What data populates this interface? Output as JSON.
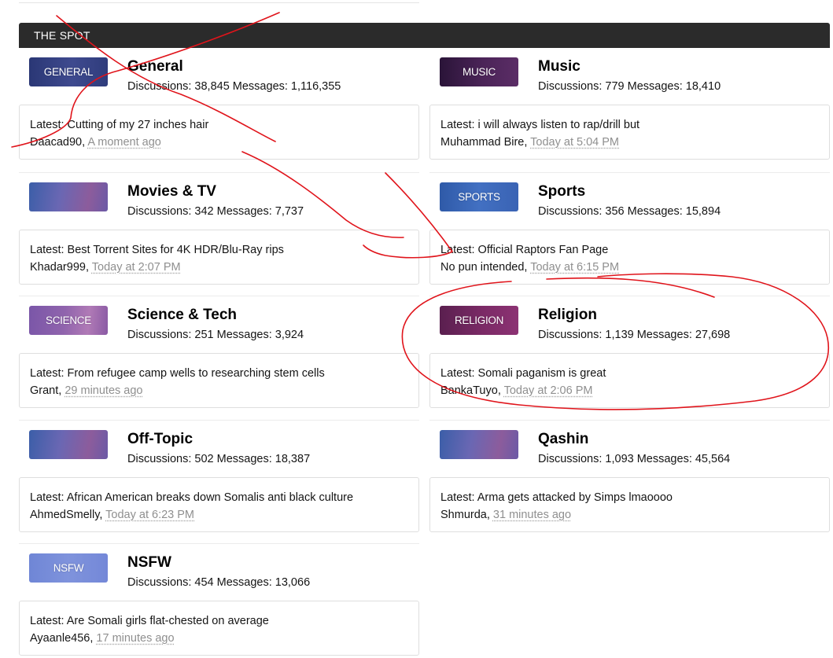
{
  "section": {
    "title": "THE SPOT"
  },
  "forums": [
    {
      "title": "General",
      "icon_label": "GENERAL",
      "icon_bg": "linear-gradient(90deg, #2a3775 0%, #3f4a8f 55%, #2f3c7c 100%)",
      "stats": "Discussions: 38,845 Messages: 1,116,355",
      "latest_title": "Latest: Cutting of my 27 inches hair",
      "latest_user": "Daacad90",
      "latest_time": "A moment ago"
    },
    {
      "title": "Music",
      "icon_label": "MUSIC",
      "icon_bg": "linear-gradient(90deg, #2a1438 0%, #4b2458 55%, #5b2d66 100%)",
      "stats": "Discussions: 779 Messages: 18,410",
      "latest_title": "Latest: i will always listen to rap/drill but",
      "latest_user": "Muhammad Bire",
      "latest_time": "Today at 5:04 PM"
    },
    {
      "title": "Movies & TV",
      "icon_label": "",
      "icon_bg": "linear-gradient(100deg, #3b5ea8 0%, #6a67b3 40%, #8c5c9c 75%, #6b5aa6 100%)",
      "stats": "Discussions: 342 Messages: 7,737",
      "latest_title": "Latest: Best Torrent Sites for 4K HDR/Blu-Ray rips",
      "latest_user": "Khadar999",
      "latest_time": "Today at 2:07 PM"
    },
    {
      "title": "Sports",
      "icon_label": "SPORTS",
      "icon_bg": "linear-gradient(90deg, #2f5aa8 0%, #4270c2 50%, #3a63b4 100%)",
      "stats": "Discussions: 356 Messages: 15,894",
      "latest_title": "Latest: Official Raptors Fan Page",
      "latest_user": "No pun intended",
      "latest_time": "Today at 6:15 PM"
    },
    {
      "title": "Science & Tech",
      "icon_label": "SCIENCE",
      "icon_bg": "linear-gradient(95deg, #7a56a8 0%, #9064ad 45%, #b07ab6 75%, #8a5aa4 100%)",
      "stats": "Discussions: 251 Messages: 3,924",
      "latest_title": "Latest: From refugee camp wells to researching stem cells",
      "latest_user": "Grant",
      "latest_time": "29 minutes ago"
    },
    {
      "title": "Religion",
      "icon_label": "RELIGION",
      "icon_bg": "linear-gradient(90deg, #5a1f4f 0%, #7b2a66 55%, #8c3273 100%)",
      "stats": "Discussions: 1,139 Messages: 27,698",
      "latest_title": "Latest: Somali paganism is great",
      "latest_user": "BankaTuyo",
      "latest_time": "Today at 2:06 PM"
    },
    {
      "title": "Off-Topic",
      "icon_label": "",
      "icon_bg": "linear-gradient(100deg, #3b5ea8 0%, #6a67b3 40%, #8c5c9c 75%, #6b5aa6 100%)",
      "stats": "Discussions: 502 Messages: 18,387",
      "latest_title": "Latest: African American breaks down Somalis anti black culture",
      "latest_user": "AhmedSmelly",
      "latest_time": "Today at 6:23 PM"
    },
    {
      "title": "Qashin",
      "icon_label": "",
      "icon_bg": "linear-gradient(100deg, #3b5ea8 0%, #6a67b3 40%, #8c5c9c 75%, #6b5aa6 100%)",
      "stats": "Discussions: 1,093 Messages: 45,564",
      "latest_title": "Latest: Arma gets attacked by Simps lmaoooo",
      "latest_user": "Shmurda",
      "latest_time": "31 minutes ago"
    },
    {
      "title": "NSFW",
      "icon_label": "NSFW",
      "icon_bg": "linear-gradient(90deg, #6f86d6 0%, #7f93dc 50%, #7488d8 100%)",
      "stats": "Discussions: 454 Messages: 13,066",
      "latest_title": "Latest: Are Somali girls flat-chested on average",
      "latest_user": "Ayaanle456",
      "latest_time": "17 minutes ago"
    }
  ],
  "annotation_color": "#e0141b"
}
